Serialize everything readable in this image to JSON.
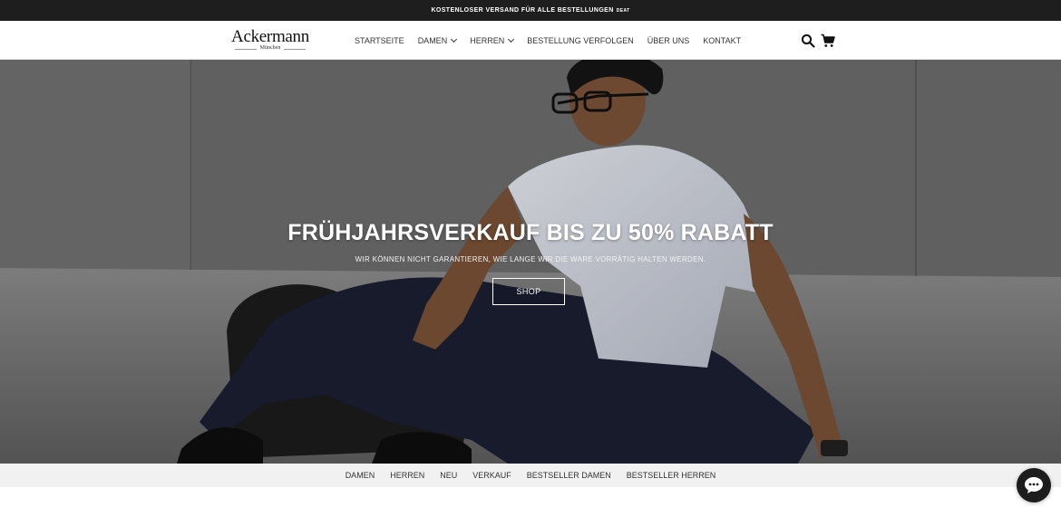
{
  "announcement": {
    "text": "KOSTENLOSER VERSAND FÜR ALLE BESTELLUNGEN",
    "suffix": "DEAT"
  },
  "logo": {
    "name": "Ackermann",
    "sub": "München"
  },
  "nav": {
    "items": [
      {
        "label": "STARTSEITE",
        "dropdown": false
      },
      {
        "label": "DAMEN",
        "dropdown": true
      },
      {
        "label": "HERREN",
        "dropdown": true
      },
      {
        "label": "BESTELLUNG VERFOLGEN",
        "dropdown": false
      },
      {
        "label": "ÜBER UNS",
        "dropdown": false
      },
      {
        "label": "KONTAKT",
        "dropdown": false
      }
    ]
  },
  "header_icons": [
    "search-icon",
    "cart-icon"
  ],
  "hero": {
    "title": "FRÜHJAHRSVERKAUF BIS ZU 50% RABATT",
    "subtitle": "WIR KÖNNEN NICHT GARANTIEREN, WIE LANGE WIR DIE WARE VORRÄTIG HALTEN WERDEN.",
    "button_label": "SHOP"
  },
  "subnav": {
    "items": [
      "DAMEN",
      "HERREN",
      "NEU",
      "VERKAUF",
      "BESTSELLER DAMEN",
      "BESTSELLER HERREN"
    ]
  },
  "chat_icon": "chat-bubble-icon",
  "colors": {
    "announce_bg": "#1e1e1e",
    "subnav_bg": "#f1f1f1",
    "text": "#333333",
    "button_border": "#ffffff"
  }
}
